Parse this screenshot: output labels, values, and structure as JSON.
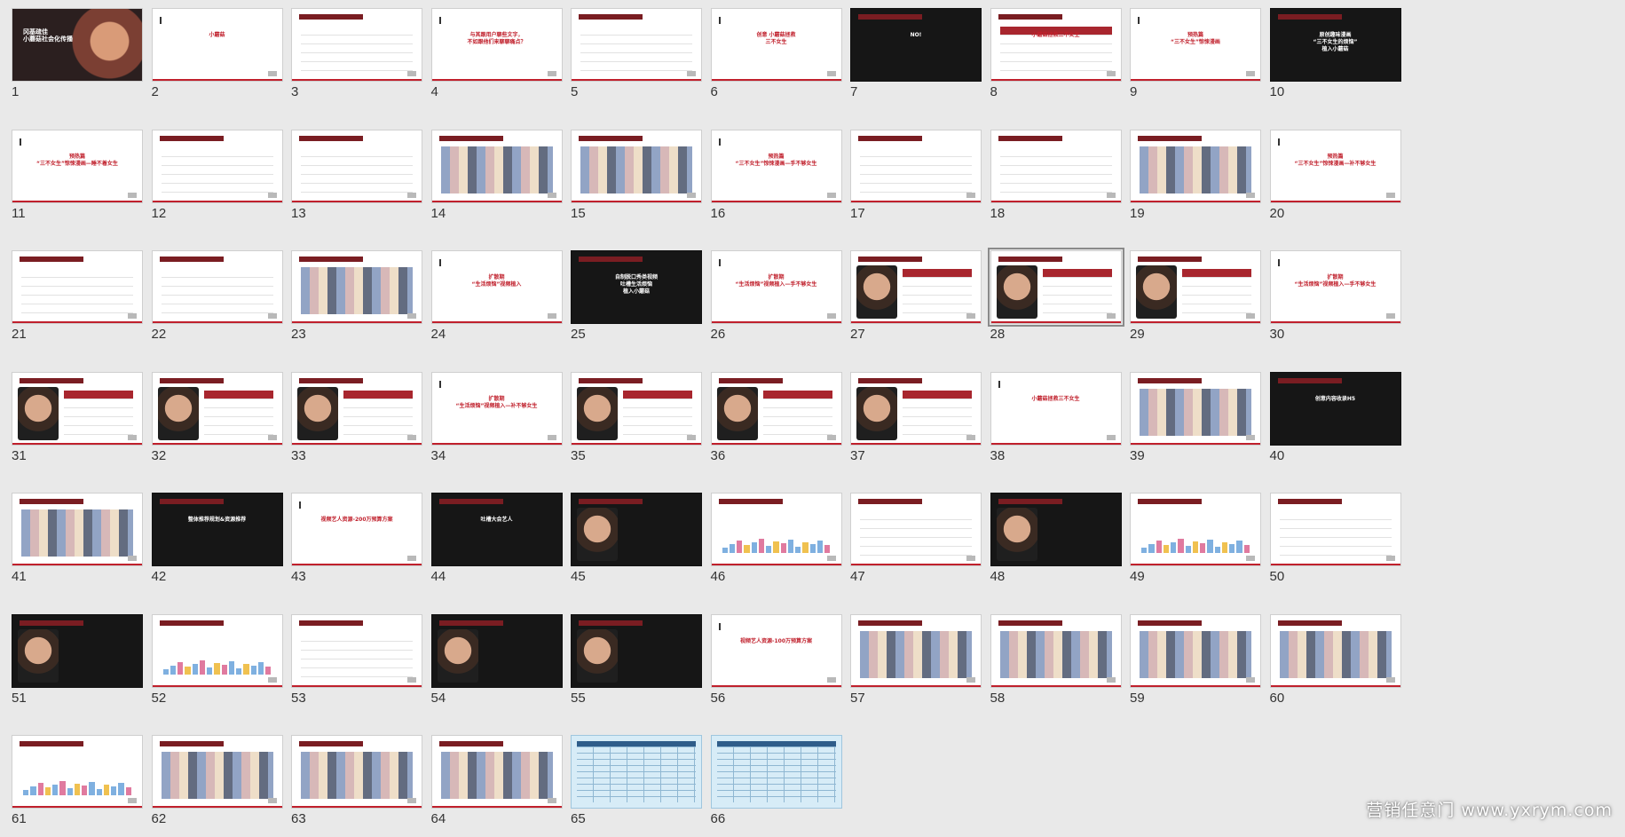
{
  "watermark": "营销任意门 www.yxrym.com",
  "colors": {
    "accent_red": "#c0202c",
    "dark_slide": "#161616",
    "table_blue": "#d7ecf7"
  },
  "slides": [
    {
      "n": "1",
      "kind": "cover",
      "text": "冈基疏佳\n小蘑菇社会化传播"
    },
    {
      "n": "2",
      "kind": "text",
      "text": "小蘑菇"
    },
    {
      "n": "3",
      "kind": "rows",
      "text": ""
    },
    {
      "n": "4",
      "kind": "text",
      "text": "与其跟用户聊些文字，\n不如跟他们来聊聊痛点？"
    },
    {
      "n": "5",
      "kind": "rows",
      "text": ""
    },
    {
      "n": "6",
      "kind": "text",
      "text": "创意 小蘑菇拯救\n三不女生"
    },
    {
      "n": "7",
      "kind": "dark",
      "text": "NO!"
    },
    {
      "n": "8",
      "kind": "table_red",
      "text": "小蘑菇拯救三不女生"
    },
    {
      "n": "9",
      "kind": "text",
      "text": "预热篇\n“三不女生”惊悚漫画"
    },
    {
      "n": "10",
      "kind": "dark",
      "text": "原创趣味漫画\n“三不女生的烦恼”\n植入小蘑菇"
    },
    {
      "n": "11",
      "kind": "text",
      "text": "预热篇\n“三不女生”惊悚漫画—睡不着女生"
    },
    {
      "n": "12",
      "kind": "rows",
      "text": ""
    },
    {
      "n": "13",
      "kind": "rows",
      "text": ""
    },
    {
      "n": "14",
      "kind": "collage",
      "text": ""
    },
    {
      "n": "15",
      "kind": "collage",
      "text": ""
    },
    {
      "n": "16",
      "kind": "text",
      "text": "预热篇\n“三不女生”惊悚漫画—手不够女生"
    },
    {
      "n": "17",
      "kind": "rows",
      "text": ""
    },
    {
      "n": "18",
      "kind": "rows",
      "text": ""
    },
    {
      "n": "19",
      "kind": "collage",
      "text": ""
    },
    {
      "n": "20",
      "kind": "text",
      "text": "预热篇\n“三不女生”惊悚漫画—补不够女生"
    },
    {
      "n": "21",
      "kind": "rows",
      "text": ""
    },
    {
      "n": "22",
      "kind": "rows",
      "text": ""
    },
    {
      "n": "23",
      "kind": "collage",
      "text": ""
    },
    {
      "n": "24",
      "kind": "text",
      "text": "扩散期\n“生活烦恼”视频植入"
    },
    {
      "n": "25",
      "kind": "dark",
      "text": "自制脱口秀类视频\n吐槽生活烦恼\n植入小蘑菇"
    },
    {
      "n": "26",
      "kind": "text",
      "text": "扩散期\n“生活烦恼”视频植入—手不够女生"
    },
    {
      "n": "27",
      "kind": "photo",
      "text": ""
    },
    {
      "n": "28",
      "kind": "photo",
      "text": "",
      "selected": true
    },
    {
      "n": "29",
      "kind": "photo",
      "text": ""
    },
    {
      "n": "30",
      "kind": "text",
      "text": "扩散期\n“生活烦恼”视频植入—手不够女生"
    },
    {
      "n": "31",
      "kind": "photo",
      "text": ""
    },
    {
      "n": "32",
      "kind": "photo",
      "text": ""
    },
    {
      "n": "33",
      "kind": "photo",
      "text": ""
    },
    {
      "n": "34",
      "kind": "text",
      "text": "扩散期\n“生活烦恼”视频植入—补不够女生"
    },
    {
      "n": "35",
      "kind": "photo",
      "text": ""
    },
    {
      "n": "36",
      "kind": "photo",
      "text": ""
    },
    {
      "n": "37",
      "kind": "photo",
      "text": ""
    },
    {
      "n": "38",
      "kind": "text",
      "text": "小蘑菇拯救三不女生"
    },
    {
      "n": "39",
      "kind": "collage",
      "text": ""
    },
    {
      "n": "40",
      "kind": "dark",
      "text": "创意内容收录H5"
    },
    {
      "n": "41",
      "kind": "collage",
      "text": ""
    },
    {
      "n": "42",
      "kind": "dark",
      "text": "整体推荐规划&资源推荐"
    },
    {
      "n": "43",
      "kind": "text",
      "text": "视频艺人资源-200万预算方案"
    },
    {
      "n": "44",
      "kind": "dark",
      "text": "吐槽大会艺人"
    },
    {
      "n": "45",
      "kind": "dark_photo",
      "text": ""
    },
    {
      "n": "46",
      "kind": "bars",
      "text": ""
    },
    {
      "n": "47",
      "kind": "rows",
      "text": ""
    },
    {
      "n": "48",
      "kind": "dark_photo",
      "text": ""
    },
    {
      "n": "49",
      "kind": "bars",
      "text": ""
    },
    {
      "n": "50",
      "kind": "rows",
      "text": ""
    },
    {
      "n": "51",
      "kind": "dark_photo",
      "text": ""
    },
    {
      "n": "52",
      "kind": "bars",
      "text": ""
    },
    {
      "n": "53",
      "kind": "rows",
      "text": ""
    },
    {
      "n": "54",
      "kind": "dark_photo",
      "text": ""
    },
    {
      "n": "55",
      "kind": "dark_photo",
      "text": ""
    },
    {
      "n": "56",
      "kind": "text",
      "text": "视频艺人资源-100万预算方案"
    },
    {
      "n": "57",
      "kind": "collage",
      "text": ""
    },
    {
      "n": "58",
      "kind": "collage",
      "text": ""
    },
    {
      "n": "59",
      "kind": "collage",
      "text": ""
    },
    {
      "n": "60",
      "kind": "collage",
      "text": ""
    },
    {
      "n": "61",
      "kind": "bars",
      "text": ""
    },
    {
      "n": "62",
      "kind": "collage",
      "text": ""
    },
    {
      "n": "63",
      "kind": "collage",
      "text": ""
    },
    {
      "n": "64",
      "kind": "collage",
      "text": ""
    },
    {
      "n": "65",
      "kind": "table",
      "text": ""
    },
    {
      "n": "66",
      "kind": "table",
      "text": ""
    }
  ]
}
